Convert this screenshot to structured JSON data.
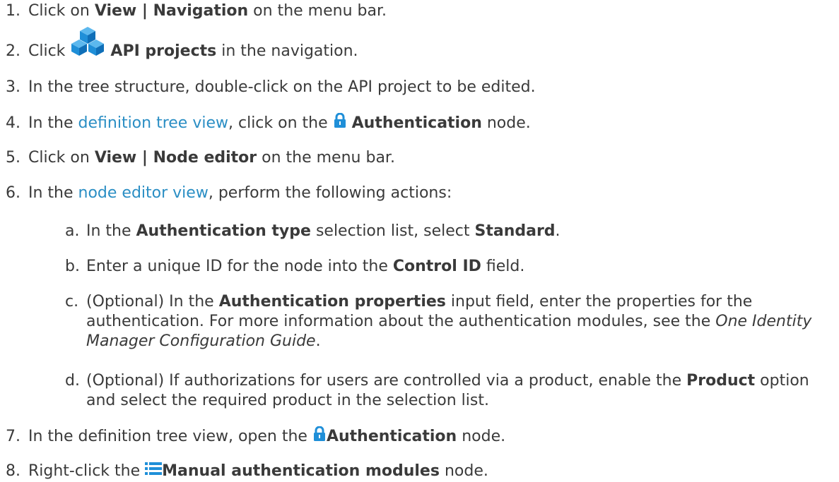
{
  "steps": [
    {
      "num": "1.",
      "t1": "Click on ",
      "b1": "View | Navigation",
      "t2": " on the menu bar."
    },
    {
      "num": "2.",
      "t1": "Click ",
      "icon": "api-projects-icon",
      "b1": "API projects",
      "t2": " in the navigation."
    },
    {
      "num": "3.",
      "t1": "In the tree structure, double-click on the API project to be edited."
    },
    {
      "num": "4.",
      "t1": "In the ",
      "link": "definition tree view",
      "t2": ", click on the ",
      "icon": "lock-icon",
      "b1": "Authentication",
      "t3": " node."
    },
    {
      "num": "5.",
      "t1": "Click on ",
      "b1": "View | Node editor",
      "t2": " on the menu bar."
    },
    {
      "num": "6.",
      "t1": "In the ",
      "link": "node editor view",
      "t2": ", perform the following actions:"
    },
    {
      "num": "7.",
      "t1": "In the definition tree view, open the ",
      "icon": "lock-icon",
      "b1": "Authentication",
      "t2": " node."
    },
    {
      "num": "8.",
      "t1": "Right-click the ",
      "icon": "list-icon",
      "b1": "Manual authentication modules",
      "t2": " node."
    }
  ],
  "substeps": [
    {
      "let": "a.",
      "t1": "In the ",
      "b1": "Authentication type",
      "t2": " selection list, select ",
      "b2": "Standard",
      "t3": "."
    },
    {
      "let": "b.",
      "t1": "Enter a unique ID for the node into the ",
      "b1": "Control ID",
      "t2": " field."
    },
    {
      "let": "c.",
      "t1": "(Optional) In the ",
      "b1": "Authentication properties",
      "t2": " input field, enter the properties for the authentication. For more information about the authentication modules, see the ",
      "i1": "One Identity Manager Configuration Guide",
      "t3": "."
    },
    {
      "let": "d.",
      "t1": "(Optional) If authorizations for users are controlled via a product, enable the ",
      "b1": "Product",
      "t2": " option and select the required product in the selection list."
    }
  ],
  "colors": {
    "link": "#2a8ec4",
    "icon_blue": "#1f8fd8",
    "text": "#3a3a3a"
  }
}
